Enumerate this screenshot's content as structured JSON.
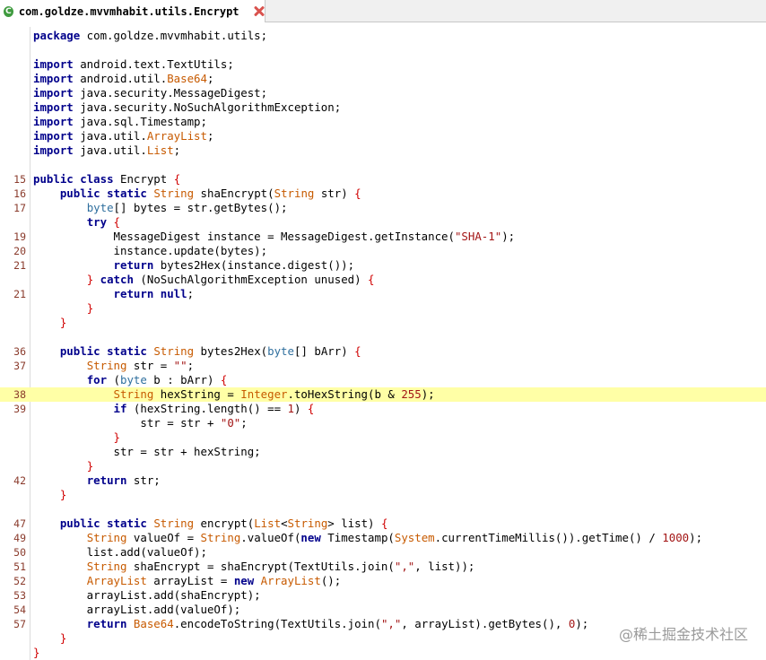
{
  "tab": {
    "title": "com.goldze.mvvmhabit.utils.Encrypt",
    "icon": "class-icon",
    "close_icon": "close-icon"
  },
  "highlighted_line_index": 25,
  "lines": [
    {
      "n": "",
      "t": [
        [
          "package",
          "kw"
        ],
        [
          " com.goldze.mvvmhabit.utils;",
          ""
        ]
      ]
    },
    {
      "n": "",
      "t": []
    },
    {
      "n": "",
      "t": [
        [
          "import",
          "kw"
        ],
        [
          " android.text.TextUtils;",
          ""
        ]
      ]
    },
    {
      "n": "",
      "t": [
        [
          "import",
          "kw"
        ],
        [
          " android.util.",
          ""
        ],
        [
          "Base64",
          "ty"
        ],
        [
          ";",
          ""
        ]
      ]
    },
    {
      "n": "",
      "t": [
        [
          "import",
          "kw"
        ],
        [
          " java.security.MessageDigest;",
          ""
        ]
      ]
    },
    {
      "n": "",
      "t": [
        [
          "import",
          "kw"
        ],
        [
          " java.security.NoSuchAlgorithmException;",
          ""
        ]
      ]
    },
    {
      "n": "",
      "t": [
        [
          "import",
          "kw"
        ],
        [
          " java.sql.Timestamp;",
          ""
        ]
      ]
    },
    {
      "n": "",
      "t": [
        [
          "import",
          "kw"
        ],
        [
          " java.util.",
          ""
        ],
        [
          "ArrayList",
          "ty"
        ],
        [
          ";",
          ""
        ]
      ]
    },
    {
      "n": "",
      "t": [
        [
          "import",
          "kw"
        ],
        [
          " java.util.",
          ""
        ],
        [
          "List",
          "ty"
        ],
        [
          ";",
          ""
        ]
      ]
    },
    {
      "n": "",
      "t": []
    },
    {
      "n": "15",
      "t": [
        [
          "public",
          "kw"
        ],
        [
          " ",
          ""
        ],
        [
          "class",
          "kw"
        ],
        [
          " Encrypt ",
          ""
        ],
        [
          "{",
          "br"
        ]
      ]
    },
    {
      "n": "16",
      "t": [
        [
          "    ",
          ""
        ],
        [
          "public",
          "kw"
        ],
        [
          " ",
          ""
        ],
        [
          "static",
          "kw"
        ],
        [
          " ",
          ""
        ],
        [
          "String",
          "ty"
        ],
        [
          " shaEncrypt(",
          ""
        ],
        [
          "String",
          "ty"
        ],
        [
          " str) ",
          ""
        ],
        [
          "{",
          "br"
        ]
      ]
    },
    {
      "n": "17",
      "t": [
        [
          "        ",
          ""
        ],
        [
          "byte",
          "tb"
        ],
        [
          "[] bytes = str.getBytes();",
          ""
        ]
      ]
    },
    {
      "n": "",
      "t": [
        [
          "        ",
          ""
        ],
        [
          "try",
          "kw"
        ],
        [
          " ",
          ""
        ],
        [
          "{",
          "br"
        ]
      ]
    },
    {
      "n": "19",
      "t": [
        [
          "            MessageDigest instance = MessageDigest.getInstance(",
          ""
        ],
        [
          "\"SHA-1\"",
          "st"
        ],
        [
          ");",
          ""
        ]
      ]
    },
    {
      "n": "20",
      "t": [
        [
          "            instance.update(bytes);",
          ""
        ]
      ]
    },
    {
      "n": "21",
      "t": [
        [
          "            ",
          ""
        ],
        [
          "return",
          "kw"
        ],
        [
          " bytes2Hex(instance.digest());",
          ""
        ]
      ]
    },
    {
      "n": "",
      "t": [
        [
          "        ",
          ""
        ],
        [
          "}",
          "br"
        ],
        [
          " ",
          ""
        ],
        [
          "catch",
          "kw"
        ],
        [
          " (NoSuchAlgorithmException unused) ",
          ""
        ],
        [
          "{",
          "br"
        ]
      ]
    },
    {
      "n": "21",
      "t": [
        [
          "            ",
          ""
        ],
        [
          "return",
          "kw"
        ],
        [
          " ",
          ""
        ],
        [
          "null",
          "kw"
        ],
        [
          ";",
          ""
        ]
      ]
    },
    {
      "n": "",
      "t": [
        [
          "        ",
          ""
        ],
        [
          "}",
          "br"
        ]
      ]
    },
    {
      "n": "",
      "t": [
        [
          "    ",
          ""
        ],
        [
          "}",
          "br"
        ]
      ]
    },
    {
      "n": "",
      "t": []
    },
    {
      "n": "36",
      "t": [
        [
          "    ",
          ""
        ],
        [
          "public",
          "kw"
        ],
        [
          " ",
          ""
        ],
        [
          "static",
          "kw"
        ],
        [
          " ",
          ""
        ],
        [
          "String",
          "ty"
        ],
        [
          " bytes2Hex(",
          ""
        ],
        [
          "byte",
          "tb"
        ],
        [
          "[] bArr) ",
          ""
        ],
        [
          "{",
          "br"
        ]
      ]
    },
    {
      "n": "37",
      "t": [
        [
          "        ",
          ""
        ],
        [
          "String",
          "ty"
        ],
        [
          " str = ",
          ""
        ],
        [
          "\"\"",
          "st"
        ],
        [
          ";",
          ""
        ]
      ]
    },
    {
      "n": "",
      "t": [
        [
          "        ",
          ""
        ],
        [
          "for",
          "kw"
        ],
        [
          " (",
          ""
        ],
        [
          "byte",
          "tb"
        ],
        [
          " b : bArr) ",
          ""
        ],
        [
          "{",
          "br"
        ]
      ]
    },
    {
      "n": "38",
      "t": [
        [
          "            ",
          ""
        ],
        [
          "String",
          "ty"
        ],
        [
          " hexString = ",
          ""
        ],
        [
          "Integer",
          "ty"
        ],
        [
          ".toHexString(b & ",
          ""
        ],
        [
          "255",
          "nu"
        ],
        [
          ");",
          ""
        ]
      ]
    },
    {
      "n": "39",
      "t": [
        [
          "            ",
          ""
        ],
        [
          "if",
          "kw"
        ],
        [
          " (hexString.length() == ",
          ""
        ],
        [
          "1",
          "nu"
        ],
        [
          ") ",
          ""
        ],
        [
          "{",
          "br"
        ]
      ]
    },
    {
      "n": "",
      "t": [
        [
          "                str = str + ",
          ""
        ],
        [
          "\"0\"",
          "st"
        ],
        [
          ";",
          ""
        ]
      ]
    },
    {
      "n": "",
      "t": [
        [
          "            ",
          ""
        ],
        [
          "}",
          "br"
        ]
      ]
    },
    {
      "n": "",
      "t": [
        [
          "            str = str + hexString;",
          ""
        ]
      ]
    },
    {
      "n": "",
      "t": [
        [
          "        ",
          ""
        ],
        [
          "}",
          "br"
        ]
      ]
    },
    {
      "n": "42",
      "t": [
        [
          "        ",
          ""
        ],
        [
          "return",
          "kw"
        ],
        [
          " str;",
          ""
        ]
      ]
    },
    {
      "n": "",
      "t": [
        [
          "    ",
          ""
        ],
        [
          "}",
          "br"
        ]
      ]
    },
    {
      "n": "",
      "t": []
    },
    {
      "n": "47",
      "t": [
        [
          "    ",
          ""
        ],
        [
          "public",
          "kw"
        ],
        [
          " ",
          ""
        ],
        [
          "static",
          "kw"
        ],
        [
          " ",
          ""
        ],
        [
          "String",
          "ty"
        ],
        [
          " encrypt(",
          ""
        ],
        [
          "List",
          "ty"
        ],
        [
          "<",
          ""
        ],
        [
          "String",
          "ty"
        ],
        [
          "> list) ",
          ""
        ],
        [
          "{",
          "br"
        ]
      ]
    },
    {
      "n": "49",
      "t": [
        [
          "        ",
          ""
        ],
        [
          "String",
          "ty"
        ],
        [
          " valueOf = ",
          ""
        ],
        [
          "String",
          "ty"
        ],
        [
          ".valueOf(",
          ""
        ],
        [
          "new",
          "kw"
        ],
        [
          " Timestamp(",
          ""
        ],
        [
          "System",
          "ty"
        ],
        [
          ".currentTimeMillis()).getTime() / ",
          ""
        ],
        [
          "1000",
          "nu"
        ],
        [
          ");",
          ""
        ]
      ]
    },
    {
      "n": "50",
      "t": [
        [
          "        list.add(valueOf);",
          ""
        ]
      ]
    },
    {
      "n": "51",
      "t": [
        [
          "        ",
          ""
        ],
        [
          "String",
          "ty"
        ],
        [
          " shaEncrypt = shaEncrypt(TextUtils.join(",
          ""
        ],
        [
          "\",\"",
          "st"
        ],
        [
          ", list));",
          ""
        ]
      ]
    },
    {
      "n": "52",
      "t": [
        [
          "        ",
          ""
        ],
        [
          "ArrayList",
          "ty"
        ],
        [
          " arrayList = ",
          ""
        ],
        [
          "new",
          "kw"
        ],
        [
          " ",
          ""
        ],
        [
          "ArrayList",
          "ty"
        ],
        [
          "();",
          ""
        ]
      ]
    },
    {
      "n": "53",
      "t": [
        [
          "        arrayList.add(shaEncrypt);",
          ""
        ]
      ]
    },
    {
      "n": "54",
      "t": [
        [
          "        arrayList.add(valueOf);",
          ""
        ]
      ]
    },
    {
      "n": "57",
      "t": [
        [
          "        ",
          ""
        ],
        [
          "return",
          "kw"
        ],
        [
          " ",
          ""
        ],
        [
          "Base64",
          "ty"
        ],
        [
          ".encodeToString(TextUtils.join(",
          ""
        ],
        [
          "\",\"",
          "st"
        ],
        [
          ", arrayList).getBytes(), ",
          ""
        ],
        [
          "0",
          "nu"
        ],
        [
          ");",
          ""
        ]
      ]
    },
    {
      "n": "",
      "t": [
        [
          "    ",
          ""
        ],
        [
          "}",
          "br"
        ]
      ]
    },
    {
      "n": "",
      "t": [
        [
          "}",
          "br"
        ]
      ]
    }
  ],
  "watermark": "@稀土掘金技术社区",
  "colors": {
    "keyword": "#00008b",
    "type": "#c75a00",
    "primitive": "#2f6f9e",
    "string": "#a31515",
    "brace": "#d00000",
    "line_number": "#8a3b2c",
    "highlight": "#ffffa6"
  }
}
